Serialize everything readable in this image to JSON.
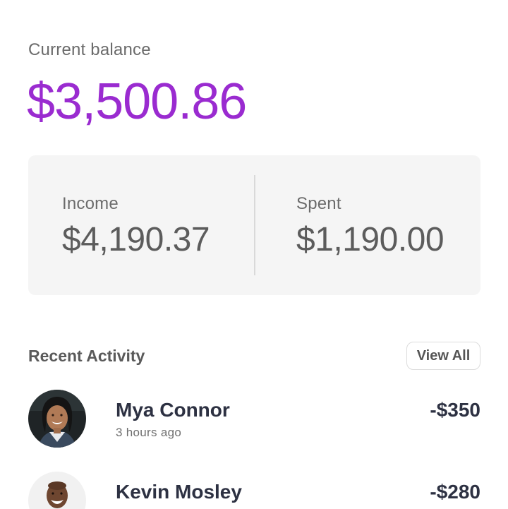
{
  "balance": {
    "label": "Current balance",
    "amount": "$3,500.86",
    "accent_color": "#9a2bd0"
  },
  "stats": {
    "income": {
      "label": "Income",
      "value": "$4,190.37"
    },
    "spent": {
      "label": "Spent",
      "value": "$1,190.00"
    }
  },
  "activity": {
    "title": "Recent Activity",
    "view_all_label": "View All",
    "items": [
      {
        "name": "Mya Connor",
        "time": "3 hours ago",
        "amount": "-$350",
        "avatar_icon": "avatar-photo"
      },
      {
        "name": "Kevin Mosley",
        "time": "",
        "amount": "-$280",
        "avatar_icon": "avatar-photo"
      }
    ]
  }
}
